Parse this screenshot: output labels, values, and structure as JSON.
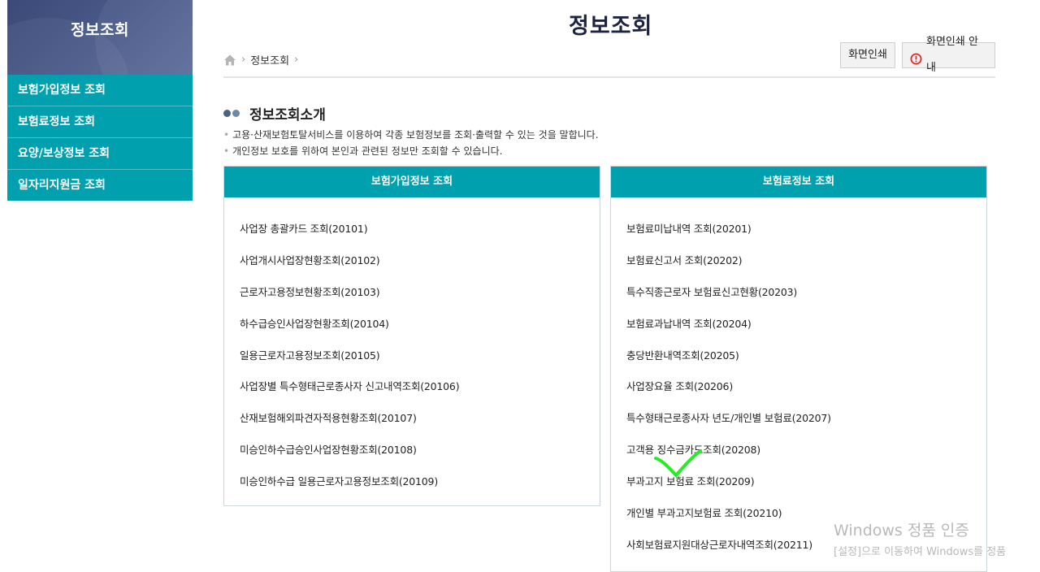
{
  "sidebar": {
    "title": "정보조회",
    "items": [
      {
        "label": "보험가입정보 조회"
      },
      {
        "label": "보험료정보 조회"
      },
      {
        "label": "요양/보상정보 조회"
      },
      {
        "label": "일자리지원금 조회"
      }
    ]
  },
  "page": {
    "title": "정보조회"
  },
  "breadcrumb": {
    "items": [
      "정보조회"
    ],
    "home_icon": "home-icon"
  },
  "toolbar": {
    "print_label": "화면인쇄",
    "guide_label": "화면인쇄 안내",
    "guide_icon": "warning-circle-icon"
  },
  "intro": {
    "title": "정보조회소개",
    "lines": [
      "고용·산재보험토탈서비스를 이용하여 각종 보험정보를 조회·출력할 수 있는 것을 말합니다.",
      "개인정보 보호를 위하여 본인과 관련된 정보만 조회할 수 있습니다."
    ]
  },
  "cards": [
    {
      "title": "보험가입정보 조회",
      "items": [
        "사업장 총괄카드 조회(20101)",
        "사업개시사업장현황조회(20102)",
        "근로자고용정보현황조회(20103)",
        "하수급승인사업장현황조회(20104)",
        "일용근로자고용정보조회(20105)",
        "사업장별 특수형태근로종사자 신고내역조회(20106)",
        "산재보험해외파견자적용현황조회(20107)",
        "미승인하수급승인사업장현황조회(20108)",
        "미승인하수급 일용근로자고용정보조회(20109)"
      ]
    },
    {
      "title": "보험료정보 조회",
      "items": [
        "보험료미납내역 조회(20201)",
        "보험료신고서 조회(20202)",
        "특수직종근로자 보험료신고현황(20203)",
        "보험료과납내역 조회(20204)",
        "충당반환내역조회(20205)",
        "사업장요율 조회(20206)",
        "특수형태근로종사자 년도/개인별 보험료(20207)",
        "고객용 징수금카드조회(20208)",
        "부과고지 보험료 조회(20209)",
        "개인별 부과고지보험료 조회(20210)",
        "사회보험료지원대상근로자내역조회(20211)"
      ]
    }
  ],
  "watermark": {
    "line1": "Windows 정품 인증",
    "line2": "[설정]으로 이동하여 Windows를 정품"
  },
  "colors": {
    "teal": "#01a0ae",
    "navy": "#3b4a78",
    "check": "#22ee22"
  }
}
